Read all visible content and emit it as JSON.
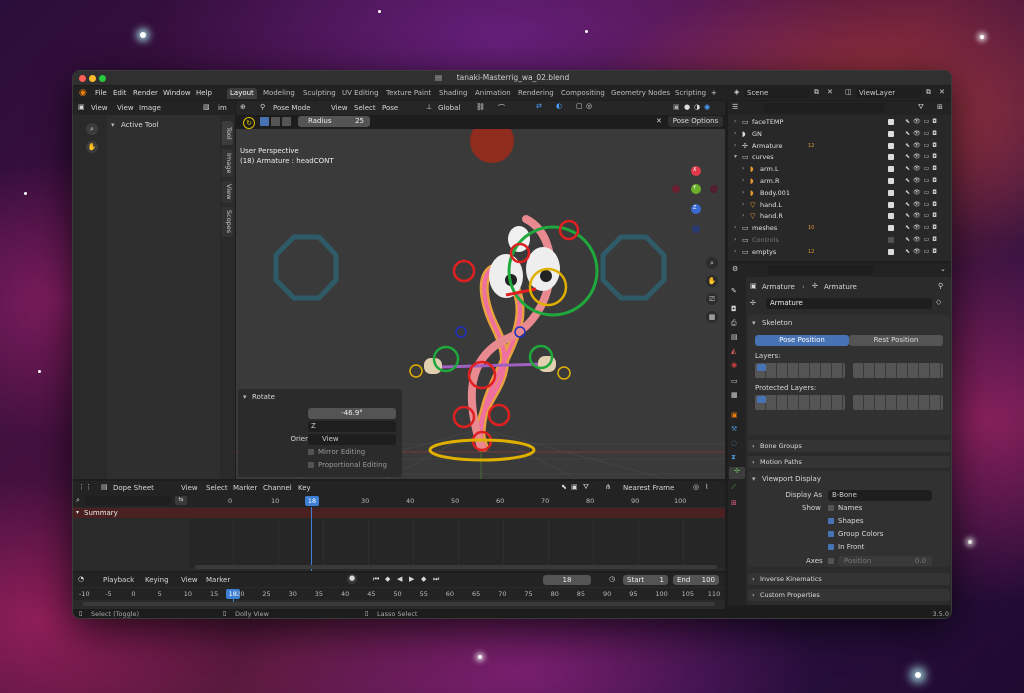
{
  "window": {
    "title": "tanaki-Masterrig_wa_02.blend",
    "version": "3.5.0"
  },
  "menu": [
    "File",
    "Edit",
    "Render",
    "Window",
    "Help"
  ],
  "workspaces": [
    "Layout",
    "Modeling",
    "Sculpting",
    "UV Editing",
    "Texture Paint",
    "Shading",
    "Animation",
    "Rendering",
    "Compositing",
    "Geometry Nodes",
    "Scripting"
  ],
  "scene": {
    "scene_name": "Scene",
    "view_layer": "ViewLayer"
  },
  "image_editor": {
    "menus": [
      "View",
      "View",
      "Image"
    ],
    "image_label": "im",
    "tool_label": "Active Tool",
    "side_tabs": [
      "Tool",
      "Image",
      "View",
      "Scopes"
    ]
  },
  "viewport": {
    "mode": "Pose Mode",
    "menus": [
      "View",
      "Select",
      "Pose"
    ],
    "radius_label": "Radius",
    "radius_value": "25",
    "transform": "Global",
    "pose_options": "Pose Options",
    "overlay_line1": "User Perspective",
    "overlay_line2": "(18) Armature : headCONT",
    "axis_x": "X",
    "axis_y": "Y",
    "axis_z": "Z"
  },
  "operator_panel": {
    "title": "Rotate",
    "angle_label": "Angle",
    "angle_value": "-46.9°",
    "axis_label": "Axis",
    "axis_value": "Z",
    "orientation_label": "Orientation",
    "orientation_value": "View",
    "mirror_label": "Mirror Editing",
    "proportional_label": "Proportional Editing"
  },
  "outliner": {
    "rows": [
      {
        "name": "faceTEMP",
        "indent": 0
      },
      {
        "name": "GN",
        "indent": 0
      },
      {
        "name": "Armature",
        "indent": 0,
        "badge": "12"
      },
      {
        "name": "curves",
        "indent": 0
      },
      {
        "name": "arm.L",
        "indent": 1
      },
      {
        "name": "arm.R",
        "indent": 1
      },
      {
        "name": "Body.001",
        "indent": 1
      },
      {
        "name": "hand.L",
        "indent": 1
      },
      {
        "name": "hand.R",
        "indent": 1
      },
      {
        "name": "meshes",
        "indent": 0,
        "badge": "10"
      },
      {
        "name": "Controls",
        "indent": 0
      },
      {
        "name": "emptys",
        "indent": 0,
        "badge": "12"
      }
    ]
  },
  "properties": {
    "breadcrumb_object": "Armature",
    "breadcrumb_data": "Armature",
    "data_name": "Armature",
    "skeleton_label": "Skeleton",
    "pose_position": "Pose Position",
    "rest_position": "Rest Position",
    "layers_label": "Layers:",
    "protected_layers_label": "Protected Layers:",
    "bone_groups": "Bone Groups",
    "motion_paths": "Motion Paths",
    "viewport_display": "Viewport Display",
    "display_as_label": "Display As",
    "display_as_value": "B-Bone",
    "show_label": "Show",
    "names": "Names",
    "shapes": "Shapes",
    "group_colors": "Group Colors",
    "in_front": "In Front",
    "axes_label": "Axes",
    "position_label": "Position",
    "position_value": "0.0",
    "inverse_kinematics": "Inverse Kinematics",
    "custom_properties": "Custom Properties",
    "checks": {
      "names": false,
      "shapes": true,
      "group_colors": true,
      "in_front": true,
      "axes": false
    }
  },
  "dopesheet": {
    "mode": "Dope Sheet",
    "menus": [
      "View",
      "Select",
      "Marker",
      "Channel",
      "Key"
    ],
    "snap": "Nearest Frame",
    "summary": "Summary",
    "ruler": [
      "0",
      "10",
      "18",
      "30",
      "40",
      "50",
      "60",
      "70",
      "80",
      "90",
      "100"
    ]
  },
  "timeline": {
    "playback": "Playback",
    "keying": "Keying",
    "menus": [
      "View",
      "Marker"
    ],
    "current_frame": "18",
    "start_label": "Start",
    "start_value": "1",
    "end_label": "End",
    "end_value": "100",
    "ruler": [
      "-10",
      "-5",
      "0",
      "5",
      "10",
      "15",
      "18",
      "20",
      "25",
      "30",
      "35",
      "40",
      "45",
      "50",
      "55",
      "60",
      "65",
      "70",
      "75",
      "80",
      "85",
      "90",
      "95",
      "100",
      "105",
      "110"
    ]
  },
  "statusbar": {
    "select": "Select (Toggle)",
    "dolly": "Dolly View",
    "lasso": "Lasso Select"
  },
  "colors": {
    "accent": "#4772b3",
    "frame_marker": "#3e7fd6",
    "bone_red": "#e02020",
    "bone_green": "#1fa83c",
    "bone_yellow": "#e0b000"
  }
}
